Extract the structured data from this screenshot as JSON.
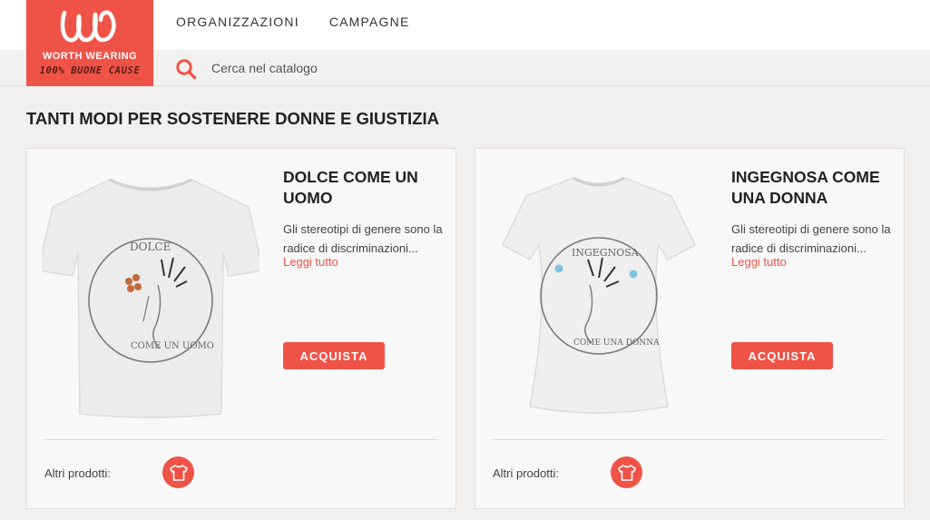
{
  "brand": {
    "name": "WORTH WEARING",
    "tagline": "100% BUONE CAUSE",
    "color": "#ef5347"
  },
  "nav": {
    "items": [
      {
        "label": "ORGANIZZAZIONI"
      },
      {
        "label": "CAMPAGNE"
      }
    ]
  },
  "search": {
    "icon": "search-icon",
    "placeholder": "Cerca nel catalogo",
    "value": ""
  },
  "page": {
    "title": "TANTI MODI PER SOSTENERE DONNE E GIUSTIZIA"
  },
  "products": [
    {
      "title": "DOLCE COME UN UOMO",
      "description": "Gli stereotipi di genere sono la radice di discriminazioni...",
      "read_more": "Leggi tutto",
      "buy_label": "ACQUISTA",
      "other_label": "Altri prodotti:",
      "other_icon": "tshirt-icon"
    },
    {
      "title": "INGEGNOSA COME UNA DONNA",
      "description": "Gli stereotipi di genere sono la radice di discriminazioni...",
      "read_more": "Leggi tutto",
      "buy_label": "ACQUISTA",
      "other_label": "Altri prodotti:",
      "other_icon": "tshirt-icon"
    }
  ]
}
